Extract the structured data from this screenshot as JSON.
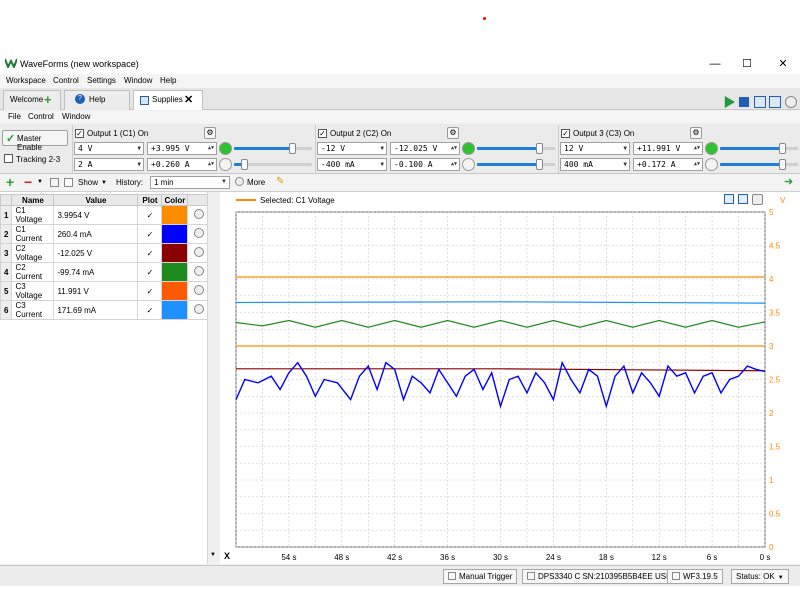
{
  "window": {
    "title": "WaveForms (new workspace)",
    "controls": [
      "—",
      "☐",
      "✕"
    ]
  },
  "menu": [
    "Workspace",
    "Control",
    "Settings",
    "Window",
    "Help"
  ],
  "tabs": [
    {
      "label": "Welcome"
    },
    {
      "label": "Help"
    },
    {
      "label": "Supplies"
    }
  ],
  "submenu": [
    "File",
    "Control",
    "Window"
  ],
  "master": {
    "label": "Master Enable",
    "tracking_label": "Tracking 2-3"
  },
  "outputs": [
    {
      "title": "Output 1 (C1) On",
      "volt_set": "4 V",
      "volt_read": "+3.995 V",
      "curr_set": "2 A",
      "curr_read": "+0.260 A",
      "led_color": "#2ec22e",
      "volt_slider": 0.74,
      "curr_slider": 0.13
    },
    {
      "title": "Output 2 (C2) On",
      "volt_set": "-12 V",
      "volt_read": "-12.025 V",
      "curr_set": "-400 mA",
      "curr_read": "-0.100 A",
      "led_color": "#2ec22e",
      "volt_slider": 0.8,
      "curr_slider": 0.8
    },
    {
      "title": "Output 3 (C3) On",
      "volt_set": "12 V",
      "volt_read": "+11.991 V",
      "curr_set": "400 mA",
      "curr_read": "+0.172 A",
      "led_color": "#2ec22e",
      "volt_slider": 0.8,
      "curr_slider": 0.8
    }
  ],
  "toolbar": {
    "show_label": "Show",
    "history_label": "History:",
    "history_value": "1 min",
    "more_label": "More"
  },
  "table": {
    "headers": [
      "Name",
      "Value",
      "Plot",
      "Color"
    ],
    "rows": [
      {
        "idx": "1",
        "name": "C1 Voltage",
        "value": "3.9954 V",
        "plot": "✓",
        "color": "#ff8c00"
      },
      {
        "idx": "2",
        "name": "C1 Current",
        "value": "260.4 mA",
        "plot": "✓",
        "color": "#0000ff"
      },
      {
        "idx": "3",
        "name": "C2 Voltage",
        "value": "-12.025 V",
        "plot": "✓",
        "color": "#8b0000"
      },
      {
        "idx": "4",
        "name": "C2 Current",
        "value": "-99.74 mA",
        "plot": "✓",
        "color": "#1e8b1e"
      },
      {
        "idx": "5",
        "name": "C3 Voltage",
        "value": "11.991 V",
        "plot": "✓",
        "color": "#ff5a00"
      },
      {
        "idx": "6",
        "name": "C3 Current",
        "value": "171.69 mA",
        "plot": "✓",
        "color": "#1e90ff"
      }
    ]
  },
  "plot": {
    "legend": "Selected: C1 Voltage",
    "x_label": "X",
    "x_ticks": [
      "54 s",
      "48 s",
      "42 s",
      "36 s",
      "30 s",
      "24 s",
      "18 s",
      "12 s",
      "6 s",
      "0 s"
    ],
    "y_ticks": [
      "5",
      "4.5",
      "4",
      "3.5",
      "3",
      "2.5",
      "2",
      "1.5",
      "1",
      "0.5",
      "0"
    ],
    "y_unit": "V",
    "axis_color": "#ff8c00"
  },
  "chart_data": {
    "type": "line",
    "x_unit": "s",
    "xlim": [
      60,
      0
    ],
    "ylim": [
      0,
      5
    ],
    "series": [
      {
        "name": "C1 Voltage",
        "color": "#ff8c00",
        "values": [
          {
            "x": 60,
            "y": 4.03
          },
          {
            "x": 0,
            "y": 4.03
          }
        ]
      },
      {
        "name": "C3 Voltage",
        "color": "#ff8c00",
        "values": [
          {
            "x": 60,
            "y": 3.0
          },
          {
            "x": 0,
            "y": 3.0
          }
        ]
      },
      {
        "name": "C3 Current",
        "color": "#1e90ff",
        "values": [
          {
            "x": 60,
            "y": 3.65
          },
          {
            "x": 30,
            "y": 3.66
          },
          {
            "x": 0,
            "y": 3.64
          }
        ]
      },
      {
        "name": "C2 Voltage",
        "color": "#8b0000",
        "values": [
          {
            "x": 60,
            "y": 2.66
          },
          {
            "x": 30,
            "y": 2.66
          },
          {
            "x": 0,
            "y": 2.63
          }
        ]
      },
      {
        "name": "C2 Current",
        "color": "#1e8b1e",
        "values": [
          {
            "x": 60,
            "y": 3.35
          },
          {
            "x": 57,
            "y": 3.3
          },
          {
            "x": 54,
            "y": 3.38
          },
          {
            "x": 51,
            "y": 3.28
          },
          {
            "x": 48,
            "y": 3.38
          },
          {
            "x": 45,
            "y": 3.28
          },
          {
            "x": 42,
            "y": 3.38
          },
          {
            "x": 39,
            "y": 3.28
          },
          {
            "x": 36,
            "y": 3.38
          },
          {
            "x": 33,
            "y": 3.28
          },
          {
            "x": 30,
            "y": 3.38
          },
          {
            "x": 27,
            "y": 3.28
          },
          {
            "x": 24,
            "y": 3.38
          },
          {
            "x": 21,
            "y": 3.28
          },
          {
            "x": 18,
            "y": 3.38
          },
          {
            "x": 15,
            "y": 3.28
          },
          {
            "x": 12,
            "y": 3.38
          },
          {
            "x": 9,
            "y": 3.28
          },
          {
            "x": 6,
            "y": 3.38
          },
          {
            "x": 3,
            "y": 3.28
          },
          {
            "x": 0,
            "y": 3.36
          }
        ]
      },
      {
        "name": "C1 Current",
        "color": "#0000ff",
        "values": [
          {
            "x": 60,
            "y": 2.2
          },
          {
            "x": 59,
            "y": 2.5
          },
          {
            "x": 57.5,
            "y": 2.45
          },
          {
            "x": 56,
            "y": 2.55
          },
          {
            "x": 55,
            "y": 2.35
          },
          {
            "x": 54,
            "y": 2.6
          },
          {
            "x": 53,
            "y": 2.75
          },
          {
            "x": 52,
            "y": 2.55
          },
          {
            "x": 51,
            "y": 2.25
          },
          {
            "x": 50,
            "y": 2.5
          },
          {
            "x": 48.5,
            "y": 2.45
          },
          {
            "x": 47,
            "y": 2.2
          },
          {
            "x": 46,
            "y": 2.55
          },
          {
            "x": 45,
            "y": 2.7
          },
          {
            "x": 44,
            "y": 2.35
          },
          {
            "x": 43,
            "y": 2.75
          },
          {
            "x": 42,
            "y": 2.65
          },
          {
            "x": 41,
            "y": 2.2
          },
          {
            "x": 40,
            "y": 2.55
          },
          {
            "x": 39,
            "y": 2.45
          },
          {
            "x": 38,
            "y": 2.3
          },
          {
            "x": 37,
            "y": 2.65
          },
          {
            "x": 36,
            "y": 2.45
          },
          {
            "x": 35,
            "y": 2.25
          },
          {
            "x": 34,
            "y": 2.55
          },
          {
            "x": 33,
            "y": 2.65
          },
          {
            "x": 32,
            "y": 2.35
          },
          {
            "x": 31,
            "y": 2.6
          },
          {
            "x": 30,
            "y": 2.1
          },
          {
            "x": 29,
            "y": 2.5
          },
          {
            "x": 28,
            "y": 2.55
          },
          {
            "x": 27,
            "y": 2.3
          },
          {
            "x": 26,
            "y": 2.6
          },
          {
            "x": 25,
            "y": 2.45
          },
          {
            "x": 24,
            "y": 2.2
          },
          {
            "x": 23,
            "y": 2.75
          },
          {
            "x": 22,
            "y": 2.5
          },
          {
            "x": 21,
            "y": 2.3
          },
          {
            "x": 20,
            "y": 2.65
          },
          {
            "x": 19,
            "y": 2.55
          },
          {
            "x": 18,
            "y": 2.1
          },
          {
            "x": 17,
            "y": 2.55
          },
          {
            "x": 16,
            "y": 2.7
          },
          {
            "x": 15,
            "y": 2.3
          },
          {
            "x": 14,
            "y": 2.6
          },
          {
            "x": 13,
            "y": 2.45
          },
          {
            "x": 12,
            "y": 2.25
          },
          {
            "x": 11,
            "y": 2.7
          },
          {
            "x": 10,
            "y": 2.55
          },
          {
            "x": 9,
            "y": 2.6
          },
          {
            "x": 8,
            "y": 2.3
          },
          {
            "x": 7,
            "y": 2.55
          },
          {
            "x": 6,
            "y": 2.6
          },
          {
            "x": 5,
            "y": 2.3
          },
          {
            "x": 4,
            "y": 2.5
          },
          {
            "x": 3,
            "y": 2.55
          },
          {
            "x": 2,
            "y": 2.7
          },
          {
            "x": 1,
            "y": 2.65
          },
          {
            "x": 0,
            "y": 2.62
          }
        ]
      }
    ]
  },
  "status": {
    "trigger": "Manual Trigger",
    "device": "DPS3340 C SN:210395B5B4EE USB",
    "version": "WF3.19.5",
    "status": "Status: OK"
  }
}
